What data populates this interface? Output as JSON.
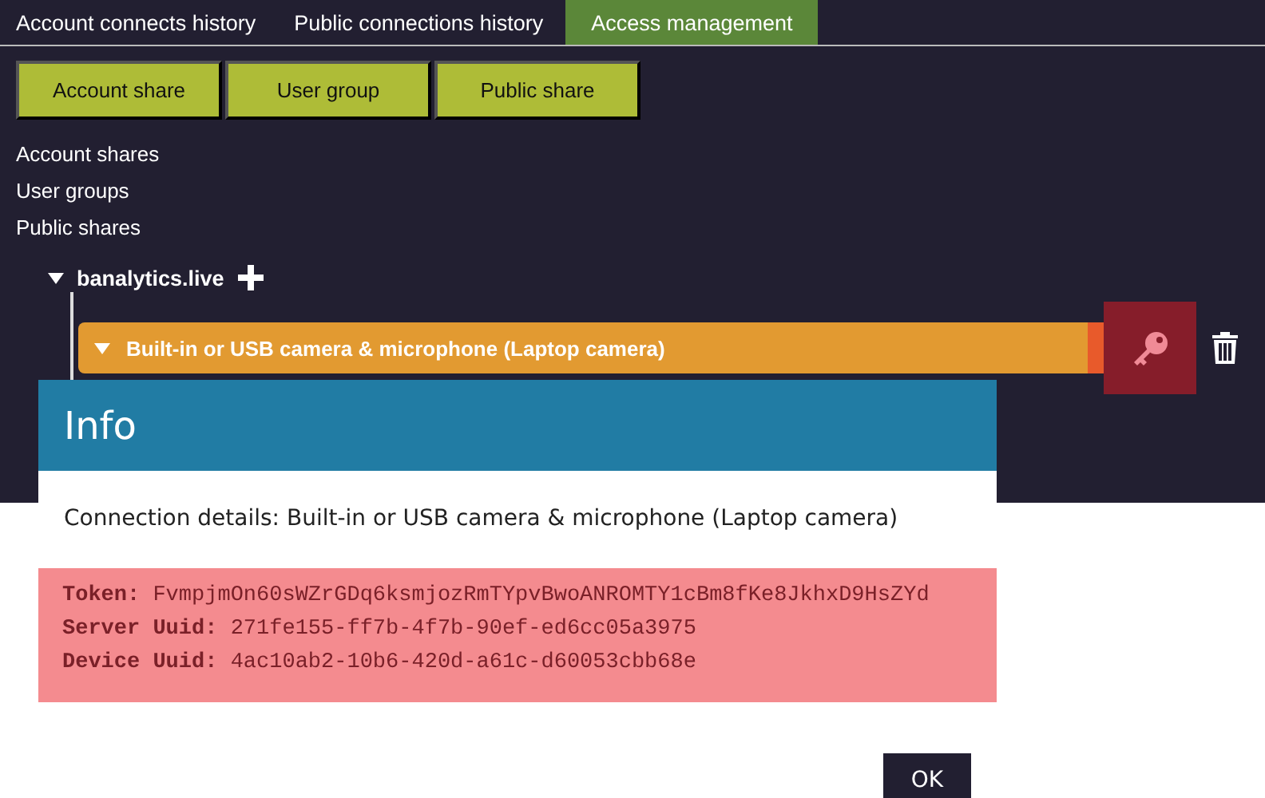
{
  "tabs": [
    {
      "label": "Account connects history",
      "selected": false
    },
    {
      "label": "Public connections history",
      "selected": false
    },
    {
      "label": "Access management",
      "selected": true
    }
  ],
  "toolbar": [
    "Account share",
    "User group",
    "Public share"
  ],
  "sections": [
    "Account shares",
    "User groups",
    "Public shares"
  ],
  "tree": [
    {
      "label": "banalytics.live",
      "expanded": true,
      "children": [
        {
          "label": "Built-in or USB camera & microphone (Laptop camera)",
          "expanded": true,
          "actions": [
            {
              "kind": "key",
              "highlighted": true
            },
            {
              "kind": "delete",
              "highlighted": false
            }
          ]
        }
      ]
    }
  ],
  "dialog": {
    "title": "Info",
    "message": "Connection details: Built-in or USB camera & microphone (Laptop camera)",
    "details": [
      {
        "label": "Token:",
        "value": "FvmpjmOn60sWZrGDq6ksmjozRmTYpvBwoANROMTY1cBm8fKe8JkhxD9HsZYd"
      },
      {
        "label": "Server Uuid:",
        "value": "271fe155-ff7b-4f7b-90ef-ed6cc05a3975"
      },
      {
        "label": "Device Uuid:",
        "value": "4ac10ab2-10b6-420d-a61c-d60053cbb68e"
      }
    ],
    "buttons": [
      "OK"
    ]
  }
}
